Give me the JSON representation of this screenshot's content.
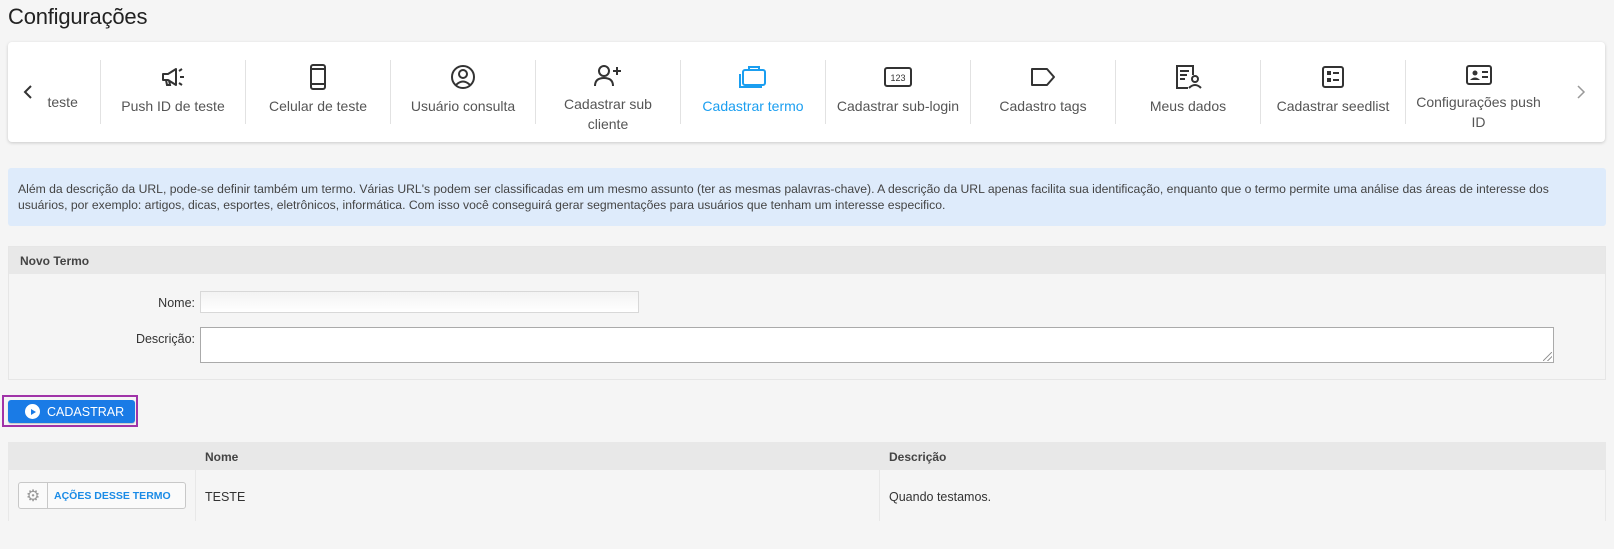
{
  "page": {
    "title": "Configurações"
  },
  "carousel": {
    "items": [
      {
        "label": "teste",
        "icon": "none"
      },
      {
        "label": "Push ID de teste",
        "icon": "megaphone-icon"
      },
      {
        "label": "Celular de teste",
        "icon": "mobile-phone-icon"
      },
      {
        "label": "Usuário consulta",
        "icon": "user-circle-icon"
      },
      {
        "label": "Cadastrar sub cliente",
        "icon": "user-add-icon"
      },
      {
        "label": "Cadastrar termo",
        "icon": "briefcase-icon",
        "active": true
      },
      {
        "label": "Cadastrar sub-login",
        "icon": "numeric-123-icon"
      },
      {
        "label": "Cadastro tags",
        "icon": "tag-icon"
      },
      {
        "label": "Meus dados",
        "icon": "user-document-icon"
      },
      {
        "label": "Cadastrar seedlist",
        "icon": "checklist-icon"
      },
      {
        "label": "Configurações push ID",
        "icon": "id-card-icon"
      }
    ],
    "active_color": "#1a9ef0"
  },
  "info": {
    "text": "Além da descrição da URL, pode-se definir também um termo. Várias URL's podem ser classificadas em um mesmo assunto (ter as mesmas palavras-chave). A descrição da URL apenas facilita sua identificação, enquanto que o termo permite uma análise das áreas de interesse dos usuários, por exemplo: artigos, dicas, esportes, eletrônicos, informática. Com isso você conseguirá gerar segmentações para usuários que tenham um interesse especifico."
  },
  "form": {
    "title": "Novo Termo",
    "name_label": "Nome:",
    "name_value": "",
    "description_label": "Descrição:",
    "description_value": ""
  },
  "actions": {
    "submit_label": "CADASTRAR",
    "primary_color": "#1a7be6"
  },
  "table": {
    "columns": [
      "",
      "Nome",
      "Descrição"
    ],
    "rows": [
      {
        "action_label": "AÇÕES DESSE TERMO",
        "name": "TESTE",
        "description": "Quando testamos."
      }
    ]
  }
}
